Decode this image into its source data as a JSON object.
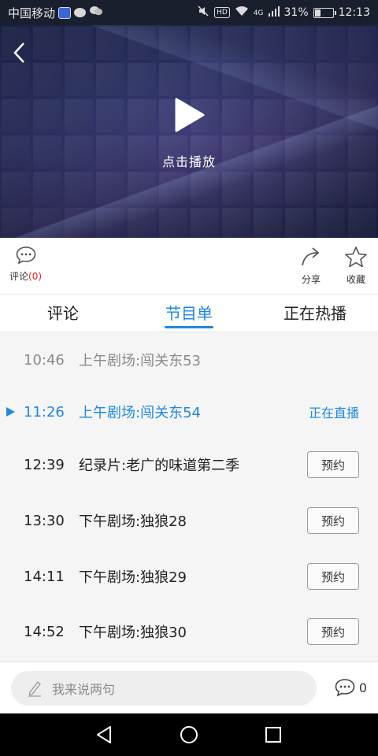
{
  "status_bar": {
    "carrier": "中国移动",
    "network": "4G",
    "hd": "HD",
    "battery_text": "31%",
    "battery_level": 0.31,
    "time": "12:13"
  },
  "player": {
    "play_label": "点击播放"
  },
  "actions": {
    "comment_label": "评论",
    "comment_count": "(0)",
    "share_label": "分享",
    "favorite_label": "收藏"
  },
  "tabs": [
    "评论",
    "节目单",
    "正在热播"
  ],
  "active_tab": 1,
  "schedule": [
    {
      "time": "10:46",
      "title": "上午剧场:闯关东53",
      "state": "past"
    },
    {
      "time": "11:26",
      "title": "上午剧场:闯关东54",
      "state": "live",
      "status": "正在直播"
    },
    {
      "time": "12:39",
      "title": "纪录片:老广的味道第二季",
      "state": "upcoming",
      "action": "预约"
    },
    {
      "time": "13:30",
      "title": "下午剧场:独狼28",
      "state": "upcoming",
      "action": "预约"
    },
    {
      "time": "14:11",
      "title": "下午剧场:独狼29",
      "state": "upcoming",
      "action": "预约"
    },
    {
      "time": "14:52",
      "title": "下午剧场:独狼30",
      "state": "upcoming",
      "action": "预约"
    }
  ],
  "comment_bar": {
    "placeholder": "我来说两句",
    "count": "0"
  },
  "colors": {
    "accent": "#1e88e5",
    "comment_count": "#e02020"
  }
}
